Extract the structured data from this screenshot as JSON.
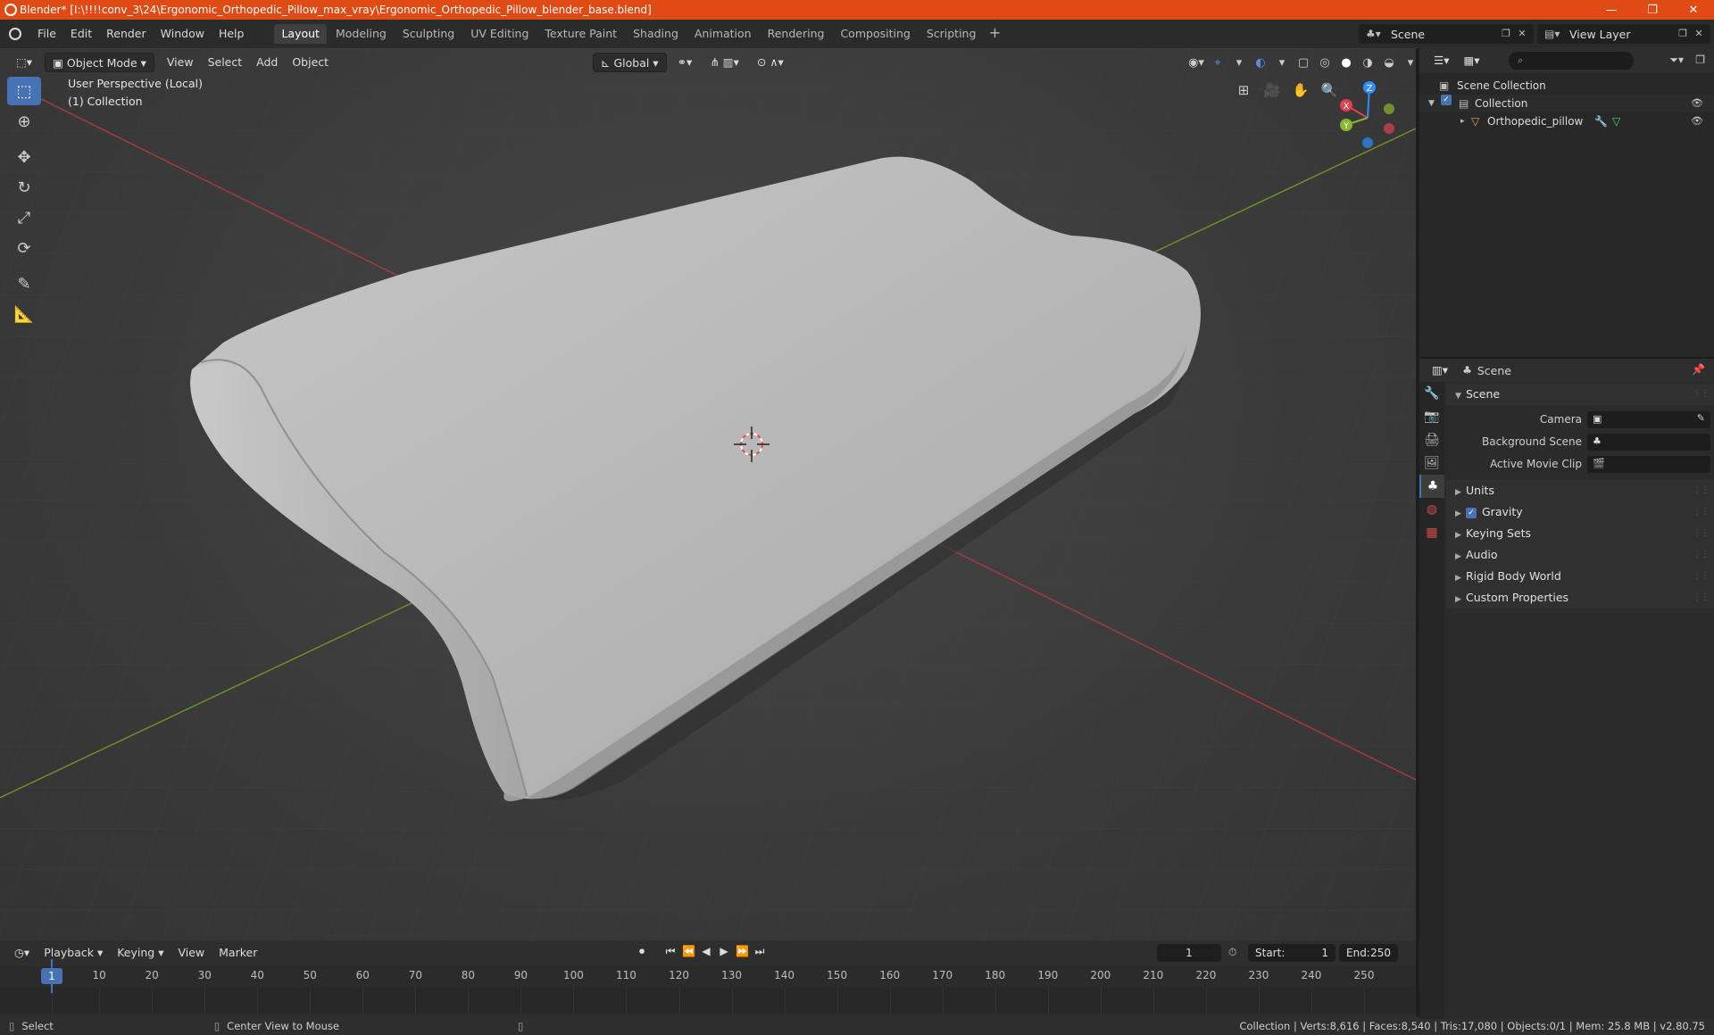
{
  "window": {
    "title": "Blender* [I:\\!!!!conv_3\\24\\Ergonomic_Orthopedic_Pillow_max_vray\\Ergonomic_Orthopedic_Pillow_blender_base.blend]",
    "minimize_glyph": "—",
    "maximize_glyph": "❐",
    "close_glyph": "✕"
  },
  "menubar": {
    "items": [
      "File",
      "Edit",
      "Render",
      "Window",
      "Help"
    ],
    "workspaces": [
      "Layout",
      "Modeling",
      "Sculpting",
      "UV Editing",
      "Texture Paint",
      "Shading",
      "Animation",
      "Rendering",
      "Compositing",
      "Scripting"
    ],
    "active_workspace": "Layout",
    "add_workspace": "+",
    "scene": "Scene",
    "view_layer": "View Layer"
  },
  "viewport": {
    "mode": "Object Mode",
    "menus": [
      "View",
      "Select",
      "Add",
      "Object"
    ],
    "transform_orientation": "Global",
    "info_line1": "User Perspective (Local)",
    "info_line2": "(1) Collection",
    "gizmo": {
      "x": "X",
      "y": "Y",
      "z": "Z"
    },
    "axis_colors": {
      "x": "#e0404e",
      "y": "#8ab629",
      "z": "#2c8fff"
    },
    "tools": [
      "select-box-icon",
      "cursor-icon",
      "move-icon",
      "rotate-icon",
      "scale-icon",
      "transform-icon",
      "annotate-icon",
      "measure-icon"
    ],
    "tool_glyphs": [
      "⬚",
      "⊕",
      "✥",
      "↻",
      "⤢",
      "⟳",
      "✎",
      "📐"
    ]
  },
  "timeline": {
    "menus": [
      "Playback",
      "Keying",
      "View",
      "Marker"
    ],
    "current_frame": "1",
    "start_label": "Start:",
    "start": "1",
    "end_label": "End:",
    "end": "250",
    "ticks": [
      "1",
      "10",
      "20",
      "30",
      "40",
      "50",
      "60",
      "70",
      "80",
      "90",
      "100",
      "110",
      "120",
      "130",
      "140",
      "150",
      "160",
      "170",
      "180",
      "190",
      "200",
      "210",
      "220",
      "230",
      "240",
      "250"
    ],
    "play_glyphs": [
      "⏺",
      "⏮",
      "⏪",
      "◀",
      "▶",
      "⏩",
      "⏭"
    ]
  },
  "statusbar": {
    "select": "Select",
    "center_view": "Center View to Mouse",
    "stats": "Collection | Verts:8,616 | Faces:8,540 | Tris:17,080 | Objects:0/1 | Mem: 25.8 MB | v2.80.75"
  },
  "outliner": {
    "search_placeholder": "⌕",
    "rows": [
      {
        "label": "Scene Collection"
      },
      {
        "label": "Collection"
      },
      {
        "label": "Orthopedic_pillow"
      }
    ]
  },
  "properties": {
    "context": "Scene",
    "panel_scene": "Scene",
    "camera_label": "Camera",
    "background_scene_label": "Background Scene",
    "active_movie_clip_label": "Active Movie Clip",
    "subpanels": [
      "Units",
      "Gravity",
      "Keying Sets",
      "Audio",
      "Rigid Body World",
      "Custom Properties"
    ],
    "gravity_checked": "✓"
  },
  "colors": {
    "titlebar": "#e04a14",
    "accent": "#4772b3",
    "viewport_bg": "#3a3a3a",
    "pillow": "#b9b9b9"
  }
}
